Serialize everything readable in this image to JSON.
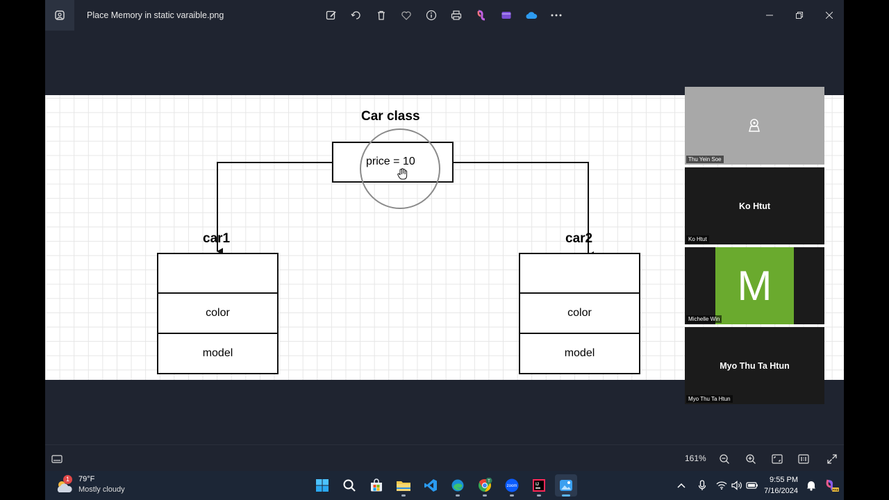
{
  "window": {
    "file_name": "Place Memory in static varaible.png",
    "toolbar_icons": [
      "edit-image-icon",
      "rotate-icon",
      "delete-icon",
      "favorite-icon",
      "info-icon",
      "print-icon",
      "copilot-icon",
      "clipchamp-icon",
      "onedrive-icon",
      "more-icon"
    ],
    "controls": [
      "minimize-icon",
      "maximize-icon",
      "close-icon"
    ]
  },
  "diagram": {
    "class_title": "Car class",
    "static_var": "price = 10",
    "objects": [
      {
        "label": "car1",
        "fields": [
          "",
          "color",
          "model"
        ]
      },
      {
        "label": "car2",
        "fields": [
          "",
          "color",
          "model"
        ]
      }
    ]
  },
  "participants": [
    {
      "name": "Thu Yein Soe",
      "display": "camera-off",
      "tile_label": ""
    },
    {
      "name": "Ko Htut",
      "display": "name",
      "tile_label": "Ko Htut"
    },
    {
      "name": "Michelle Win",
      "display": "avatar",
      "tile_label": "M",
      "avatar_color": "#6aaa2e"
    },
    {
      "name": "Myo Thu Ta Htun",
      "display": "name",
      "tile_label": "Myo Thu Ta Htun"
    }
  ],
  "bottom_bar": {
    "zoom": "161%"
  },
  "taskbar": {
    "weather_badge": "1",
    "temperature": "79°F",
    "condition": "Mostly cloudy",
    "apps": [
      "start-icon",
      "search-icon",
      "store-icon",
      "file-explorer-icon",
      "vscode-icon",
      "edge-icon",
      "chrome-icon",
      "zoom-icon",
      "intellij-icon",
      "photos-icon"
    ],
    "time": "9:55 PM",
    "date": "7/16/2024",
    "accent": "#5bb5f5"
  }
}
